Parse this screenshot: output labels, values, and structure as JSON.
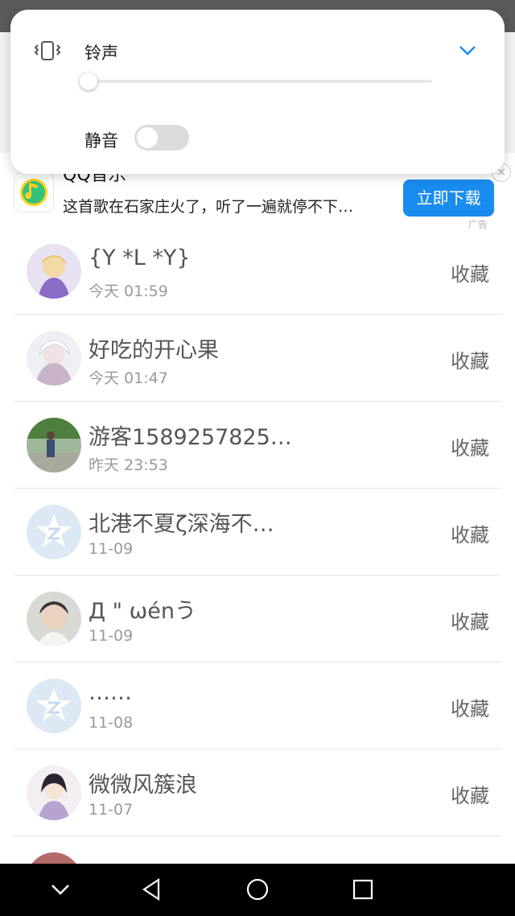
{
  "volume_panel": {
    "ring_label": "铃声",
    "ring_level": 0.0,
    "mute_label": "静音",
    "mute_on": false,
    "icons": [
      "vibrate-icon",
      "chevron-down-icon"
    ]
  },
  "ad": {
    "title": "QQ音乐",
    "description": "这首歌在石家庄火了，听了一遍就停不下…",
    "download_label": "立即下载",
    "tag": "广告",
    "close_symbol": "×",
    "icons": [
      "qq-music-logo-icon",
      "close-icon"
    ]
  },
  "list": [
    {
      "name": "{Y *L *Y}",
      "time": "今天 01:59",
      "action": "收藏",
      "avatar": "anime-girl-purple"
    },
    {
      "name": "好吃的开心果",
      "time": "今天 01:47",
      "action": "收藏",
      "avatar": "anime-white-hair"
    },
    {
      "name": "游客1589257825…",
      "time": "昨天 23:53",
      "action": "收藏",
      "avatar": "photo-person-outdoor"
    },
    {
      "name": "北港不夏ζ深海不…",
      "time": "11-09",
      "action": "收藏",
      "avatar": "qzone-default"
    },
    {
      "name": "Д \" ωénう",
      "time": "11-09",
      "action": "收藏",
      "avatar": "photo-face"
    },
    {
      "name": "……",
      "time": "11-08",
      "action": "收藏",
      "avatar": "qzone-default"
    },
    {
      "name": "微微风簇浪",
      "time": "11-07",
      "action": "收藏",
      "avatar": "anime-girl-lavender"
    }
  ],
  "nav": {
    "icons": [
      "chevron-down-icon",
      "back-triangle-icon",
      "home-circle-icon",
      "recents-square-icon"
    ]
  },
  "colors": {
    "accent": "#1a8cf0",
    "nav_bg": "#000000",
    "text_primary": "#555555",
    "text_secondary": "#9a9a9a"
  }
}
